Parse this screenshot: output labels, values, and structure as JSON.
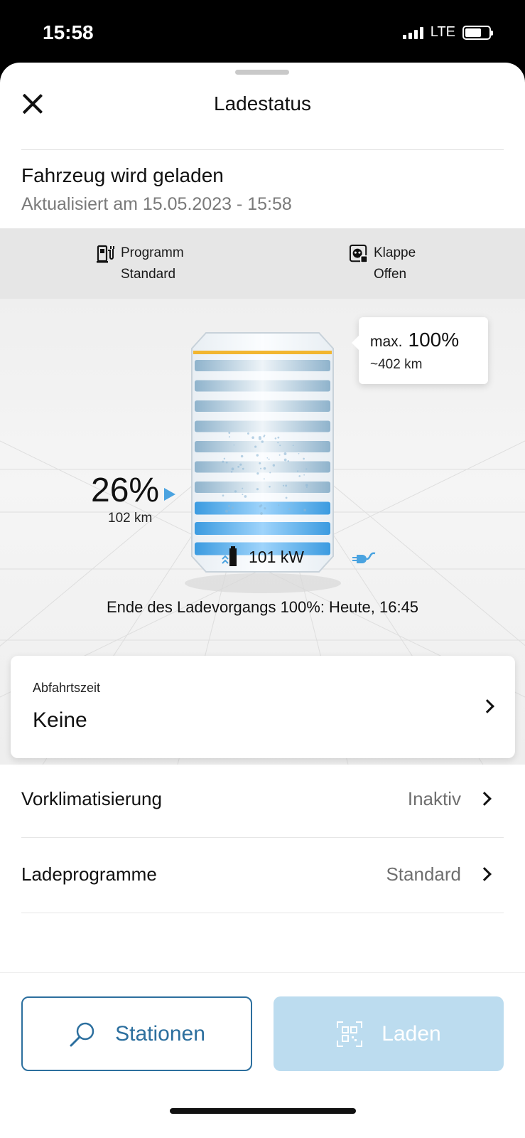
{
  "status_bar": {
    "time": "15:58",
    "network": "LTE"
  },
  "header": {
    "title": "Ladestatus"
  },
  "charging": {
    "status": "Fahrzeug wird geladen",
    "updated": "Aktualisiert am 15.05.2023 - 15:58"
  },
  "info": {
    "program_label": "Programm",
    "program_value": "Standard",
    "flap_label": "Klappe",
    "flap_value": "Offen"
  },
  "battery": {
    "percent": "26%",
    "range": "102 km",
    "level_fraction": 0.26,
    "power": "101 kW",
    "max_label": "max.",
    "max_percent": "100%",
    "max_range": "~402 km",
    "end_of_charge": "Ende des Ladevorgangs 100%: Heute, 16:45"
  },
  "departure": {
    "label": "Abfahrtszeit",
    "value": "Keine"
  },
  "list": [
    {
      "label": "Vorklimatisierung",
      "value": "Inaktiv"
    },
    {
      "label": "Ladeprogramme",
      "value": "Standard"
    }
  ],
  "actions": {
    "stations": "Stationen",
    "charge": "Laden"
  },
  "colors": {
    "accent": "#2c6f9e",
    "charge_blue": "#4aa3e0",
    "max_line": "#f2b630",
    "disabled_button": "#bcdcef"
  }
}
